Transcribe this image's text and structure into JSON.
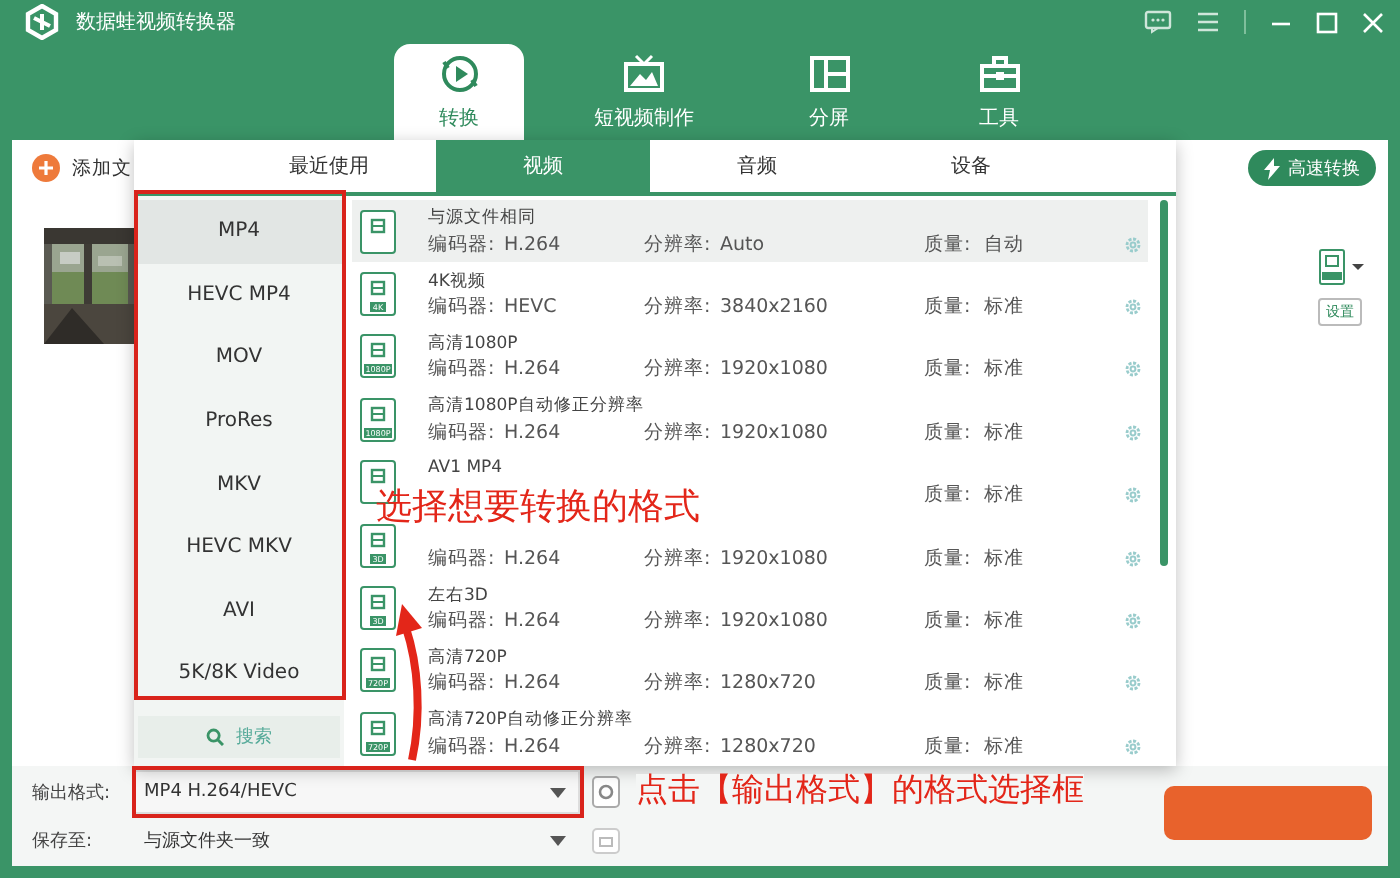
{
  "window": {
    "title": "数据蛙视频转换器"
  },
  "main_tabs": [
    {
      "label": "转换",
      "selected": true
    },
    {
      "label": "短视频制作",
      "selected": false
    },
    {
      "label": "分屏",
      "selected": false
    },
    {
      "label": "工具",
      "selected": false
    }
  ],
  "toolbar": {
    "add_file": "添加文",
    "fast_convert": "高速转换",
    "settings": "设置"
  },
  "format_panel": {
    "tabs": [
      {
        "label": "最近使用",
        "selected": false
      },
      {
        "label": "视频",
        "selected": true
      },
      {
        "label": "音频",
        "selected": false
      },
      {
        "label": "设备",
        "selected": false
      }
    ],
    "formats": [
      {
        "label": "MP4",
        "selected": true
      },
      {
        "label": "HEVC MP4",
        "selected": false
      },
      {
        "label": "MOV",
        "selected": false
      },
      {
        "label": "ProRes",
        "selected": false
      },
      {
        "label": "MKV",
        "selected": false
      },
      {
        "label": "HEVC MKV",
        "selected": false
      },
      {
        "label": "AVI",
        "selected": false
      },
      {
        "label": "5K/8K Video",
        "selected": false
      }
    ],
    "search": "搜索",
    "presets": [
      {
        "name": "与源文件相同",
        "selected": true,
        "codec_label": "编码器:",
        "codec": "H.264",
        "res_label": "分辨率:",
        "res": "Auto",
        "quality_label": "质量:",
        "quality": "自动"
      },
      {
        "name": "4K视频",
        "badge": "4K",
        "selected": false,
        "codec_label": "编码器:",
        "codec": "HEVC",
        "res_label": "分辨率:",
        "res": "3840x2160",
        "quality_label": "质量:",
        "quality": "标准"
      },
      {
        "name": "高清1080P",
        "badge": "1080P",
        "selected": false,
        "codec_label": "编码器:",
        "codec": "H.264",
        "res_label": "分辨率:",
        "res": "1920x1080",
        "quality_label": "质量:",
        "quality": "标准"
      },
      {
        "name": "高清1080P自动修正分辨率",
        "badge": "1080P",
        "selected": false,
        "codec_label": "编码器:",
        "codec": "H.264",
        "res_label": "分辨率:",
        "res": "1920x1080",
        "quality_label": "质量:",
        "quality": "标准"
      },
      {
        "name": "AV1 MP4",
        "selected": false,
        "quality_label": "质量:",
        "quality": "标准"
      },
      {
        "badge": "3D",
        "selected": false,
        "codec_label": "编码器:",
        "codec": "H.264",
        "res_label": "分辨率:",
        "res": "1920x1080",
        "quality_label": "质量:",
        "quality": "标准"
      },
      {
        "name": "左右3D",
        "badge": "3D",
        "selected": false,
        "codec_label": "编码器:",
        "codec": "H.264",
        "res_label": "分辨率:",
        "res": "1920x1080",
        "quality_label": "质量:",
        "quality": "标准"
      },
      {
        "name": "高清720P",
        "badge": "720P",
        "selected": false,
        "codec_label": "编码器:",
        "codec": "H.264",
        "res_label": "分辨率:",
        "res": "1280x720",
        "quality_label": "质量:",
        "quality": "标准"
      },
      {
        "name": "高清720P自动修正分辨率",
        "badge": "720P",
        "selected": false,
        "codec_label": "编码器:",
        "codec": "H.264",
        "res_label": "分辨率:",
        "res": "1280x720",
        "quality_label": "质量:",
        "quality": "标准"
      }
    ]
  },
  "bottom": {
    "output_label": "输出格式:",
    "output_value": "MP4 H.264/HEVC",
    "save_label": "保存至:",
    "save_value": "与源文件夹一致"
  },
  "annotations": [
    {
      "text": "选择想要转换的格式"
    },
    {
      "text": "点击【输出格式】的格式选择框"
    }
  ]
}
